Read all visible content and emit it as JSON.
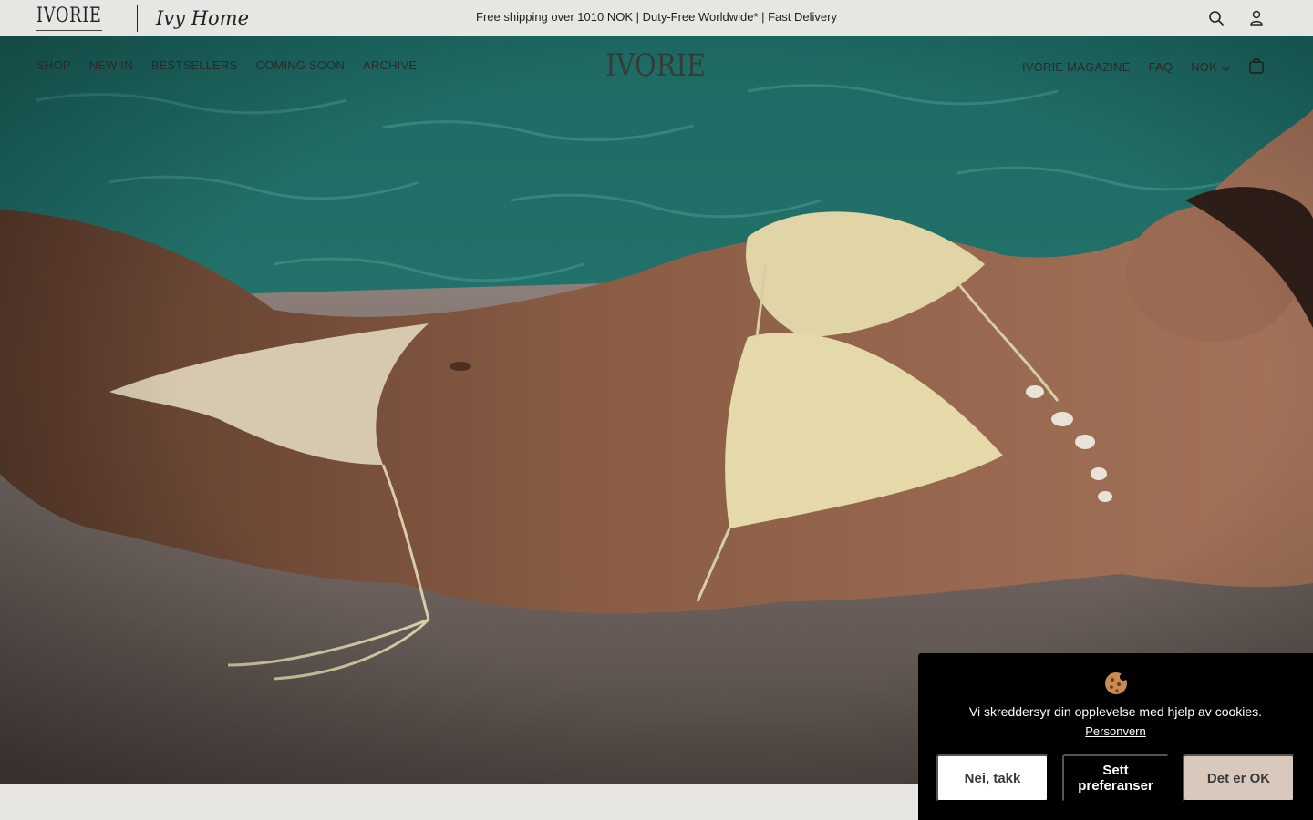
{
  "topbar": {
    "logo_text": "IVORIE",
    "sister_brand": "Ivy Home",
    "announcement": "Free shipping over 1010 NOK | Duty-Free Worldwide* | Fast Delivery",
    "icons": [
      "search-icon",
      "account-icon"
    ]
  },
  "nav": {
    "left": [
      "SHOP",
      "NEW IN",
      "BESTSELLERS",
      "COMING SOON",
      "ARCHIVE"
    ],
    "center_logo": "IVORIE",
    "right": [
      "IVORIE MAGAZINE",
      "FAQ"
    ],
    "currency": "NOK",
    "cart_icon": "shopping-bag-icon"
  },
  "cookie": {
    "message": "Vi skreddersyr din opplevelse med hjelp av cookies.",
    "privacy_link": "Personvern",
    "decline_label": "Nei, takk",
    "prefs_label": "Sett preferanser",
    "accept_label": "Det er OK",
    "accept_color": "#d9c8bc"
  },
  "colors": {
    "background": "#e7e6e2",
    "banner": "#000000"
  }
}
